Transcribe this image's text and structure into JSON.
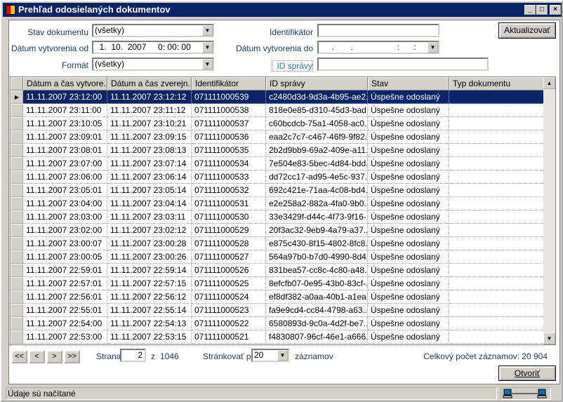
{
  "window": {
    "title": "Prehľad odosielaných dokumentov",
    "minimize": "_",
    "maximize": "□",
    "close": "×"
  },
  "filters": {
    "stav_label": "Stav dokumentu",
    "stav_value": "(všetky)",
    "od_label": "Dátum vytvorenia od",
    "od_value": "  1.  10.  2007     0: 00: 00",
    "format_label": "Formát",
    "format_value": "(všetky)",
    "identifikator_label": "Identifikátor",
    "identifikator_value": "",
    "do_label": "Dátum vytvorenia do",
    "do_value": "     .       .                   :      :",
    "id_spravy_label": "ID správy",
    "id_spravy_value": "",
    "refresh": "Aktualizovať"
  },
  "grid": {
    "columns": [
      "Dátum a čas vytvore...",
      "Dátum a čas zverejn...",
      "Identifikátor",
      "ID správy",
      "Stav",
      "Typ dokumentu"
    ],
    "rows": [
      [
        "11.11.2007 23:12:00",
        "11.11.2007 23:12:12",
        "071111000539",
        "c2480d3d-9d3a-4b95-ae2...",
        "Úspešne odoslaný",
        ""
      ],
      [
        "11.11.2007 23:11:00",
        "11.11.2007 23:11:12",
        "071111000538",
        "818e0e85-d310-45d3-bad...",
        "Úspešne odoslaný",
        ""
      ],
      [
        "11.11.2007 23:10:05",
        "11.11.2007 23:10:21",
        "071111000537",
        "c60bcdcb-75a1-4058-ac0...",
        "Úspešne odoslaný",
        ""
      ],
      [
        "11.11.2007 23:09:01",
        "11.11.2007 23:09:15",
        "071111000536",
        "eaa2c7c7-c467-46f9-9f82...",
        "Úspešne odoslaný",
        ""
      ],
      [
        "11.11.2007 23:08:01",
        "11.11.2007 23:08:13",
        "071111000535",
        "2b2d9bb9-69a2-409e-a11...",
        "Úspešne odoslaný",
        ""
      ],
      [
        "11.11.2007 23:07:00",
        "11.11.2007 23:07:14",
        "071111000534",
        "7e504e83-5bec-4d84-bdd...",
        "Úspešne odoslaný",
        ""
      ],
      [
        "11.11.2007 23:06:00",
        "11.11.2007 23:06:14",
        "071111000533",
        "dd72cc17-ad95-4e5c-937...",
        "Úspešne odoslaný",
        ""
      ],
      [
        "11.11.2007 23:05:01",
        "11.11.2007 23:05:14",
        "071111000532",
        "692c421e-71aa-4c08-bd4...",
        "Úspešne odoslaný",
        ""
      ],
      [
        "11.11.2007 23:04:00",
        "11.11.2007 23:04:14",
        "071111000531",
        "e2e258a2-882a-4fa0-9b0...",
        "Úspešne odoslaný",
        ""
      ],
      [
        "11.11.2007 23:03:00",
        "11.11.2007 23:03:11",
        "071111000530",
        "33e3429f-d44c-4f73-9f16-...",
        "Úspešne odoslaný",
        ""
      ],
      [
        "11.11.2007 23:02:00",
        "11.11.2007 23:02:12",
        "071111000529",
        "20f3ac32-9eb9-4a79-a37...",
        "Úspešne odoslaný",
        ""
      ],
      [
        "11.11.2007 23:00:07",
        "11.11.2007 23:00:28",
        "071111000528",
        "e875c430-8f15-4802-8fc8...",
        "Úspešne odoslaný",
        ""
      ],
      [
        "11.11.2007 23:00:05",
        "11.11.2007 23:00:26",
        "071111000527",
        "564a97b0-b7d0-4990-8d4...",
        "Úspešne odoslaný",
        ""
      ],
      [
        "11.11.2007 22:59:01",
        "11.11.2007 22:59:14",
        "071111000526",
        "831bea57-cc8c-4c80-a48...",
        "Úspešne odoslaný",
        ""
      ],
      [
        "11.11.2007 22:57:01",
        "11.11.2007 22:57:15",
        "071111000525",
        "8efcfb07-0e95-43b0-83cf-...",
        "Úspešne odoslaný",
        ""
      ],
      [
        "11.11.2007 22:56:01",
        "11.11.2007 22:56:12",
        "071111000524",
        "ef8df382-a0aa-40b1-a1ea...",
        "Úspešne odoslaný",
        ""
      ],
      [
        "11.11.2007 22:55:01",
        "11.11.2007 22:55:14",
        "071111000523",
        "fa9e9cd4-cc84-4798-a63...",
        "Úspešne odoslaný",
        ""
      ],
      [
        "11.11.2007 22:54:00",
        "11.11.2007 22:54:13",
        "071111000522",
        "6580893d-9c0a-4d2f-be7...",
        "Úspešne odoslaný",
        ""
      ],
      [
        "11.11.2007 22:53:00",
        "11.11.2007 22:53:15",
        "071111000521",
        "f4830807-96cf-46e1-a666...",
        "Úspešne odoslaný",
        ""
      ]
    ],
    "selected_row": 0
  },
  "pager": {
    "first": "<<",
    "prev": "<",
    "next": ">",
    "last": ">>",
    "page_label": "Strana",
    "page": "2",
    "of_label": "z",
    "total_pages": "1046",
    "page_size_label": "Stránkovať po",
    "page_size": "20",
    "records_label": "záznamov",
    "total_label": "Celkový počet záznamov: 20 904"
  },
  "open_button": "Otvoriť",
  "status": {
    "text": "Údaje sú načítané"
  }
}
